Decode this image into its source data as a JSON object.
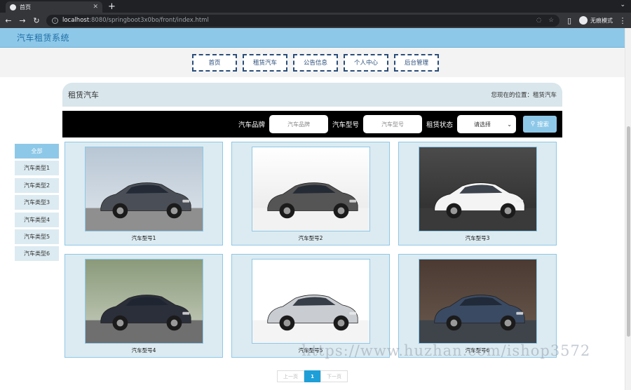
{
  "browser": {
    "tab_title": "首页",
    "new_tab": "+",
    "url_host": "localhost",
    "url_path": ":8080/springboot3x0bo/front/index.html",
    "profile_label": "无痕模式"
  },
  "header": {
    "site_title": "汽车租赁系统"
  },
  "menu": [
    {
      "label": "首页"
    },
    {
      "label": "租赁汽车"
    },
    {
      "label": "公告信息"
    },
    {
      "label": "个人中心"
    },
    {
      "label": "后台管理"
    }
  ],
  "crumb": {
    "title": "租赁汽车",
    "location": "您现在的位置：租赁汽车"
  },
  "search": {
    "brand_label": "汽车品牌",
    "brand_placeholder": "汽车品牌",
    "model_label": "汽车型号",
    "model_placeholder": "汽车型号",
    "status_label": "租赁状态",
    "status_value": "请选择",
    "button_label": "搜索"
  },
  "sidebar": [
    {
      "label": "全部",
      "active": true
    },
    {
      "label": "汽车类型1"
    },
    {
      "label": "汽车类型2"
    },
    {
      "label": "汽车类型3"
    },
    {
      "label": "汽车类型4"
    },
    {
      "label": "汽车类型5"
    },
    {
      "label": "汽车类型6"
    }
  ],
  "cars": [
    {
      "caption": "汽车型号1",
      "color": "#4a4f57",
      "scene": "city"
    },
    {
      "caption": "汽车型号2",
      "color": "#555555",
      "scene": "studio"
    },
    {
      "caption": "汽车型号3",
      "color": "#f4f4f4",
      "scene": "dark"
    },
    {
      "caption": "汽车型号4",
      "color": "#2b2f3a",
      "scene": "road"
    },
    {
      "caption": "汽车型号5",
      "color": "#c9ccd0",
      "scene": "white"
    },
    {
      "caption": "汽车型号6",
      "color": "#3a4a63",
      "scene": "street"
    }
  ],
  "pager": {
    "prev": "上一页",
    "current": "1",
    "next": "下一页"
  },
  "watermark": "https://www.huzhan.com/ishop3572"
}
